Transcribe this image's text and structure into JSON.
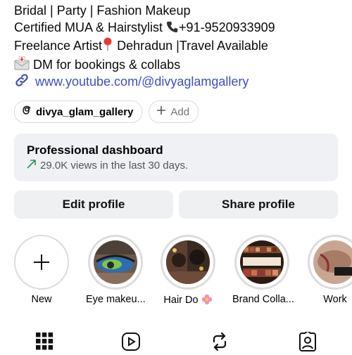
{
  "bio": {
    "line1": "Bridal | Party | Fashion Makeup",
    "line2_text": "Certified MUA & Hairstylist ",
    "line2_phone": "+91-9520933909",
    "line3_text": "Freelance Artist",
    "line3_rest": " Dehradun |Travel Available",
    "line4_text": " DM for bookings & collabs"
  },
  "link": {
    "url_text": "www.youtube.com/@divyaglamgallery"
  },
  "chips": {
    "threads_handle": "divya_glam_gallery",
    "add_label": "Add"
  },
  "dashboard": {
    "title": "Professional dashboard",
    "subtitle": "29.0K views in the last 30 days."
  },
  "buttons": {
    "edit": "Edit profile",
    "share": "Share profile"
  },
  "highlights": [
    {
      "label": "New"
    },
    {
      "label": "Eye makeu..."
    },
    {
      "label": "Hair Do"
    },
    {
      "label": "Brand Colla..."
    },
    {
      "label": "Work"
    }
  ],
  "icons": {
    "phone": "phone-icon",
    "pin": "pin-icon",
    "mail": "mail-icon",
    "link": "link-icon",
    "threads": "threads-icon",
    "trend": "trend-up-icon",
    "plus": "plus-icon",
    "grid": "grid-icon",
    "reels": "reels-icon",
    "repost": "repost-icon",
    "tagged": "tagged-icon"
  },
  "colors": {
    "link": "#3b4fc0",
    "trend": "#1e9a5a",
    "chip_border": "#dbdbdb",
    "panel": "#f0f1f4"
  }
}
